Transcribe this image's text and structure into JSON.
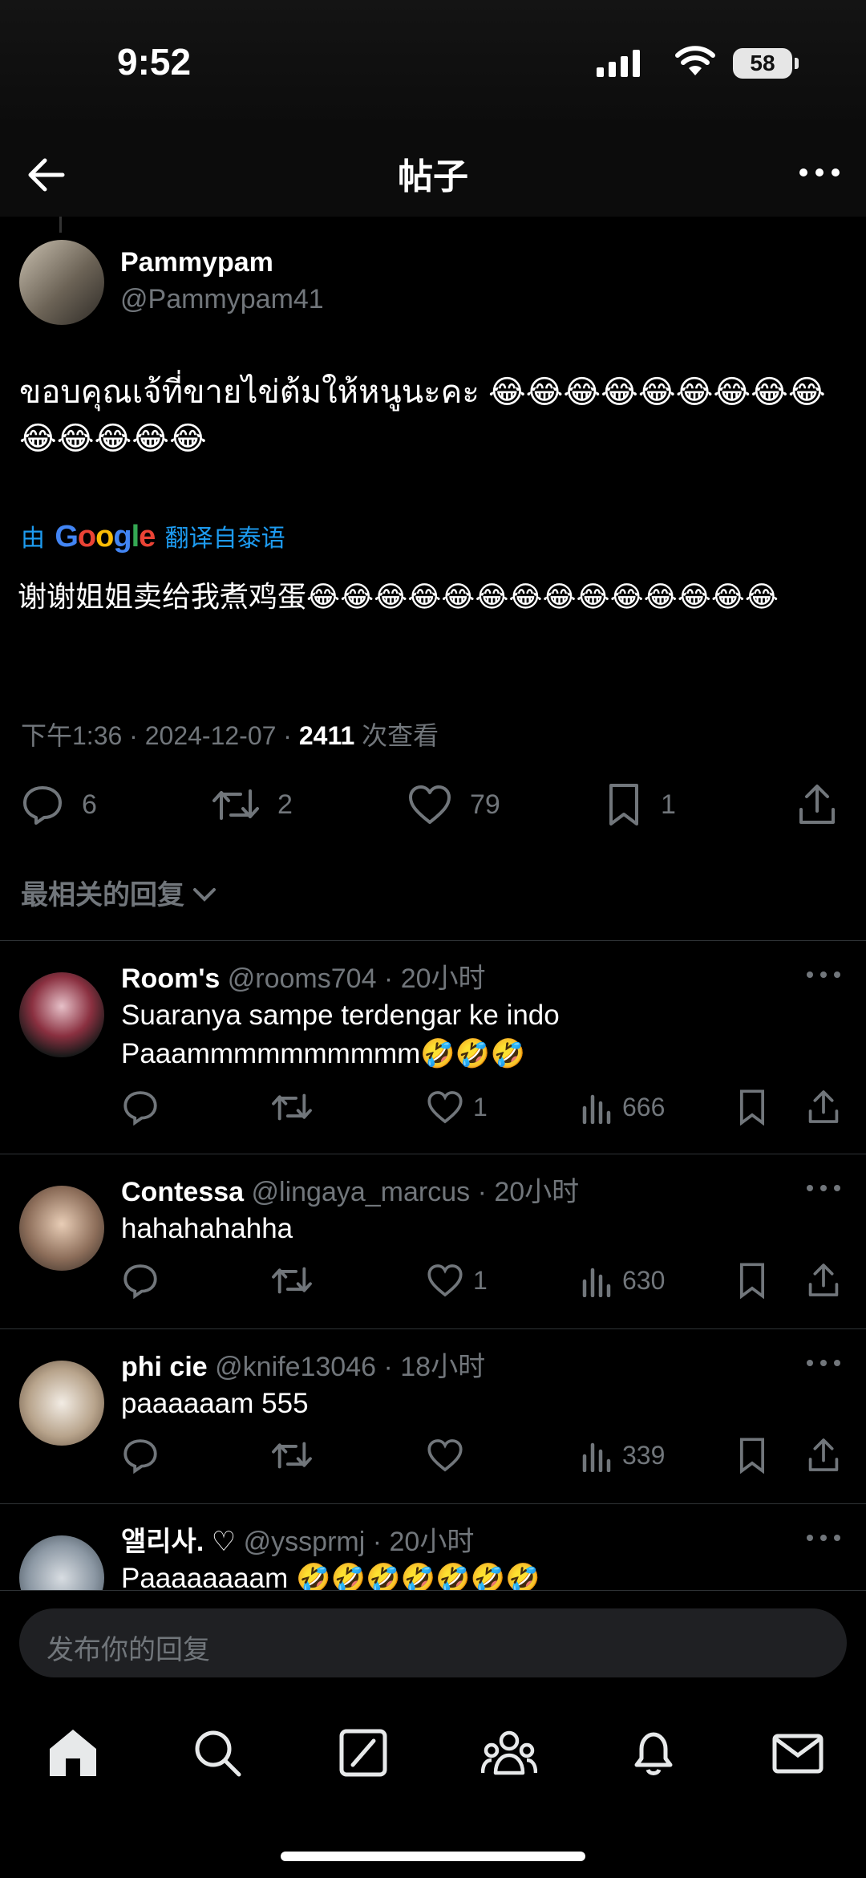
{
  "status_bar": {
    "time": "9:52",
    "battery": "58"
  },
  "header": {
    "title": "帖子"
  },
  "post": {
    "display_name": "Pammypam",
    "handle": "@Pammypam41",
    "text": "ขอบคุณเจ้ที่ขายไข่ต้มให้หนูนะคะ 😂😂😂😂😂😂😂😂😂😂😂😂😂😂",
    "translate_prefix": "由",
    "translate_brand": "Google",
    "translate_suffix": "翻译自泰语",
    "translated_text": "谢谢姐姐卖给我煮鸡蛋😂😂😂😂😂😂😂😂😂😂😂😂😂😂",
    "meta_time": "下午1:36 · 2024-12-07 · ",
    "views_count": "2411",
    "views_label": " 次查看",
    "stats": {
      "replies": "6",
      "reposts": "2",
      "likes": "79",
      "bookmarks": "1"
    }
  },
  "sort_label": "最相关的回复",
  "replies": [
    {
      "name": "Room's",
      "handle": "@rooms704 · 20小时",
      "text": "Suaranya sampe terdengar ke indo Paaammmmmmmmmm🤣🤣🤣",
      "likes": "1",
      "views": "666"
    },
    {
      "name": "Contessa",
      "handle": "@lingaya_marcus · 20小时",
      "text": "hahahahahha",
      "likes": "1",
      "views": "630"
    },
    {
      "name": "phi cie",
      "handle": "@knife13046 · 18小时",
      "text": "paaaaaam 555",
      "likes": "",
      "views": "339"
    },
    {
      "name": "앨리사. ♡",
      "handle": "@yssprmj · 20小时",
      "text": "Paaaaaaaam 🤣🤣🤣🤣🤣🤣🤣"
    }
  ],
  "composer": {
    "placeholder": "发布你的回复"
  },
  "tabs": [
    "home-icon",
    "search-icon",
    "grok-icon",
    "communities-icon",
    "notifications-icon",
    "messages-icon"
  ]
}
